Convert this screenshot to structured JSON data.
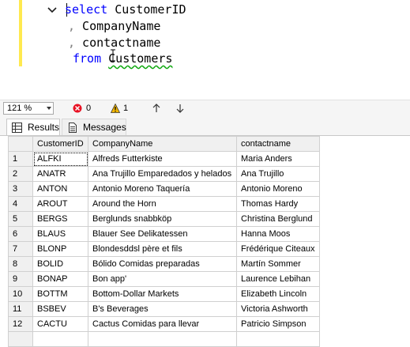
{
  "editor": {
    "line1_kw": "select",
    "line1_rest": " CustomerID",
    "line2_comma": ",",
    "line2_text": " CompanyName",
    "line3_comma": ",",
    "line3_text": " contactname",
    "line4_kw": "from",
    "line4_space": " ",
    "line4_table": "Customers"
  },
  "status": {
    "zoom": "121 %",
    "errors": "0",
    "warnings": "1"
  },
  "tabs": {
    "results": "Results",
    "messages": "Messages"
  },
  "grid": {
    "columns": [
      "CustomerID",
      "CompanyName",
      "contactname"
    ],
    "rows": [
      {
        "n": "1",
        "id": "ALFKI",
        "company": "Alfreds Futterkiste",
        "contact": "Maria Anders"
      },
      {
        "n": "2",
        "id": "ANATR",
        "company": "Ana Trujillo Emparedados y helados",
        "contact": "Ana Trujillo"
      },
      {
        "n": "3",
        "id": "ANTON",
        "company": "Antonio Moreno Taquería",
        "contact": "Antonio Moreno"
      },
      {
        "n": "4",
        "id": "AROUT",
        "company": "Around the Horn",
        "contact": "Thomas Hardy"
      },
      {
        "n": "5",
        "id": "BERGS",
        "company": "Berglunds snabbköp",
        "contact": "Christina Berglund"
      },
      {
        "n": "6",
        "id": "BLAUS",
        "company": "Blauer See Delikatessen",
        "contact": "Hanna Moos"
      },
      {
        "n": "7",
        "id": "BLONP",
        "company": "Blondesddsl père et fils",
        "contact": "Frédérique Citeaux"
      },
      {
        "n": "8",
        "id": "BOLID",
        "company": "Bólido Comidas preparadas",
        "contact": "Martín Sommer"
      },
      {
        "n": "9",
        "id": "BONAP",
        "company": "Bon app'",
        "contact": "Laurence Lebihan"
      },
      {
        "n": "10",
        "id": "BOTTM",
        "company": "Bottom-Dollar Markets",
        "contact": "Elizabeth Lincoln"
      },
      {
        "n": "11",
        "id": "BSBEV",
        "company": "B's Beverages",
        "contact": "Victoria Ashworth"
      },
      {
        "n": "12",
        "id": "CACTU",
        "company": "Cactus Comidas para llevar",
        "contact": "Patricio Simpson"
      },
      {
        "n": "",
        "id": "",
        "company": "",
        "contact": ""
      }
    ]
  },
  "icons": {
    "collapse": "collapse-minus-icon",
    "error": "error-circle-icon",
    "warning": "warning-triangle-icon",
    "results": "grid-icon",
    "messages": "document-icon"
  },
  "colors": {
    "keyword": "#0000ff",
    "error": "#e81123",
    "warning_fill": "#f2b600",
    "change_bar": "#ffe94f",
    "squiggle": "#0ea80e"
  }
}
